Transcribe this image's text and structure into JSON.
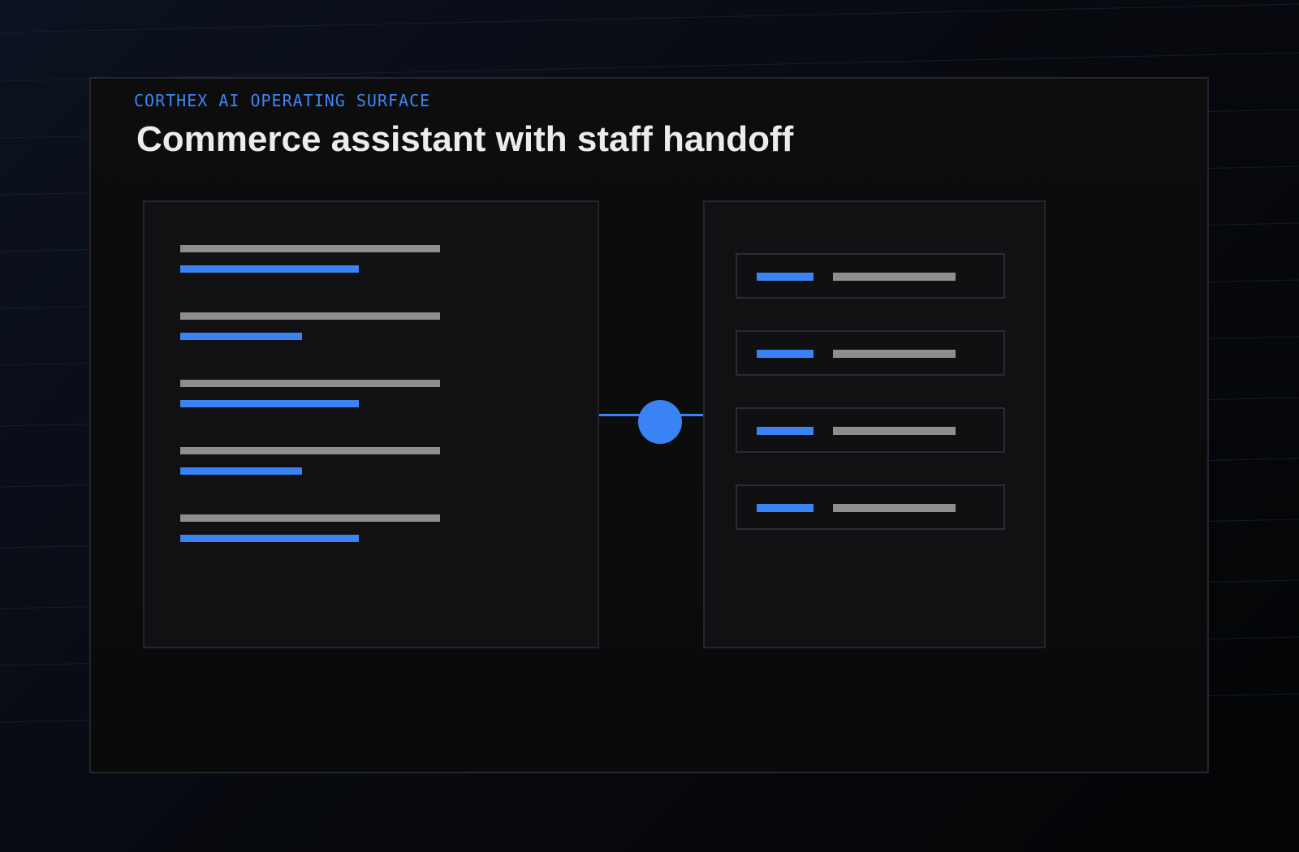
{
  "header": {
    "eyebrow": "CORTHEX AI OPERATING SURFACE",
    "title": "Commerce assistant with staff handoff"
  },
  "colors": {
    "accent": "#3a83f4",
    "bar_gray": "#8e8e8e",
    "panel_bg": "#111114",
    "card_bg": "#0b0b0c",
    "title_text": "#ececec"
  },
  "diagram": {
    "left_panel": {
      "placeholder_lines": 5
    },
    "connector": {
      "node_shape": "circle"
    },
    "right_panel": {
      "placeholder_rows": 4
    }
  }
}
